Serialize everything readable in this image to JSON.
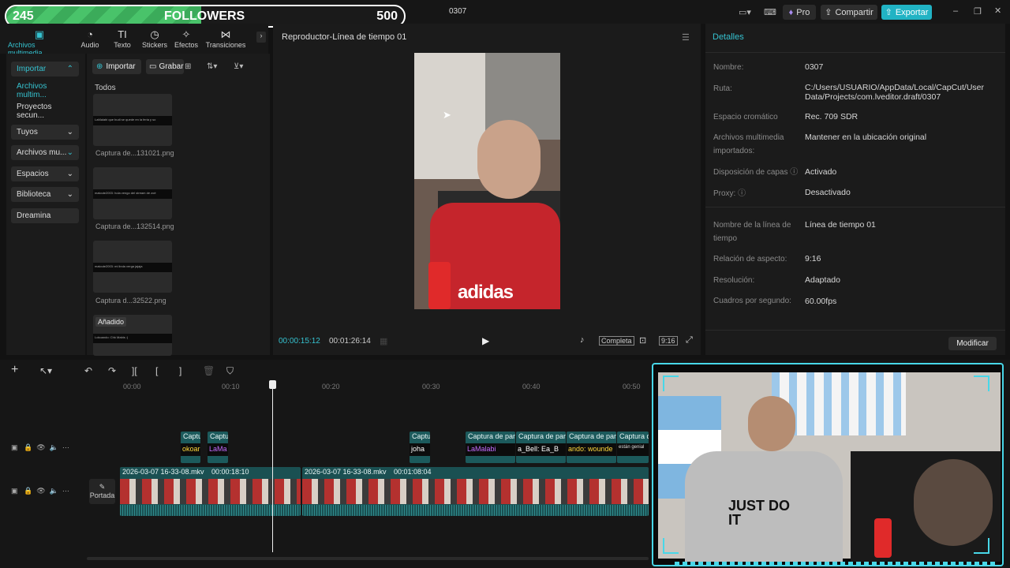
{
  "window": {
    "title": "0307"
  },
  "overlay": {
    "left_count": "245",
    "label": "FOLLOWERS",
    "right_count": "500",
    "progress": 0.49
  },
  "topbar": {
    "pro": "Pro",
    "share": "Compartir",
    "export": "Exportar"
  },
  "tools": [
    {
      "label": "Archivos multimedia",
      "icon": "media-icon"
    },
    {
      "label": "Audio",
      "icon": "audio-icon"
    },
    {
      "label": "Texto",
      "icon": "text-icon"
    },
    {
      "label": "Stickers",
      "icon": "sticker-icon"
    },
    {
      "label": "Efectos",
      "icon": "effects-icon"
    },
    {
      "label": "Transiciones",
      "icon": "transitions-icon"
    }
  ],
  "sidenav": [
    {
      "label": "Importar",
      "chev": "⌃"
    },
    {
      "label": "Archivos multim...",
      "chev": ""
    },
    {
      "label": "Proyectos secun...",
      "chev": ""
    },
    {
      "label": "Tuyos",
      "chev": "⌄"
    },
    {
      "label": "Archivos mu...",
      "chev": "⌄"
    },
    {
      "label": "Espacios",
      "chev": "⌄"
    },
    {
      "label": "Biblioteca",
      "chev": "⌄"
    },
    {
      "label": "Dreamina",
      "chev": ""
    }
  ],
  "media": {
    "import_btn": "Importar",
    "record_btn": "Grabar",
    "filter_all": "Todos",
    "items": [
      {
        "caption": "Captura de...131021.png",
        "text": "LaMalabi que budi se quede en la feria y so"
      },
      {
        "caption": "Captura de...132514.png",
        "text": "malcute2003: hola vengo del stream de zoé"
      },
      {
        "caption": "Captura d...32522.png",
        "text": "malcute2003: mi linda verga jajaja"
      },
      {
        "caption": "",
        "badge": "Añadido",
        "text": "Lokoando: Chk Mabis :)"
      }
    ]
  },
  "player": {
    "title": "Reproductor-Línea de tiempo 01",
    "current": "00:00:15:12",
    "total": "00:01:26:14",
    "quality": "Completa",
    "ratio": "9:16",
    "shirt_text": "adidas"
  },
  "details": {
    "title": "Detalles",
    "rows": [
      {
        "label": "Nombre:",
        "value": "0307"
      },
      {
        "label": "Ruta:",
        "value": "C:/Users/USUARIO/AppData/Local/CapCut/User Data/Projects/com.lveditor.draft/0307"
      },
      {
        "label": "Espacio cromático",
        "value": "Rec. 709 SDR"
      },
      {
        "label": "Archivos multimedia importados:",
        "value": "Mantener en la ubicación original"
      },
      {
        "label": "Disposición de capas ⓘ",
        "value": "Activado"
      },
      {
        "label": "Proxy: ⓘ",
        "value": "Desactivado"
      },
      {
        "label": "Nombre de la línea de tiempo",
        "value": "Línea de tiempo 01"
      },
      {
        "label": "Relación de aspecto:",
        "value": "9:16"
      },
      {
        "label": "Resolución:",
        "value": "Adaptado"
      },
      {
        "label": "Cuadros por segundo:",
        "value": "60.00fps"
      }
    ],
    "modify_btn": "Modificar"
  },
  "timeline": {
    "ticks": [
      "00:00",
      "00:10",
      "00:20",
      "00:30",
      "00:40",
      "00:50"
    ],
    "cover_label": "Portada",
    "clips": [
      {
        "label": "Captu",
        "sub": "okoar"
      },
      {
        "label": "Captu",
        "sub": "LaMa"
      },
      {
        "label": "Captu",
        "sub": "joha"
      },
      {
        "label": "Captura de par",
        "sub": "LaMalabi"
      },
      {
        "label": "Captura de par",
        "sub": "a_Bell: Ea_B"
      },
      {
        "label": "Captura de par",
        "sub": "ando: wounde"
      },
      {
        "label": "Captura d",
        "sub": "están genial"
      }
    ],
    "video_clips": [
      {
        "name": "2026-03-07 16-33-08.mkv",
        "dur": "00:00:18:10"
      },
      {
        "name": "2026-03-07 16-33-08.mkv",
        "dur": "00:01:08:04"
      }
    ]
  },
  "webcam": {
    "shirt_text": "JUST DO IT"
  }
}
